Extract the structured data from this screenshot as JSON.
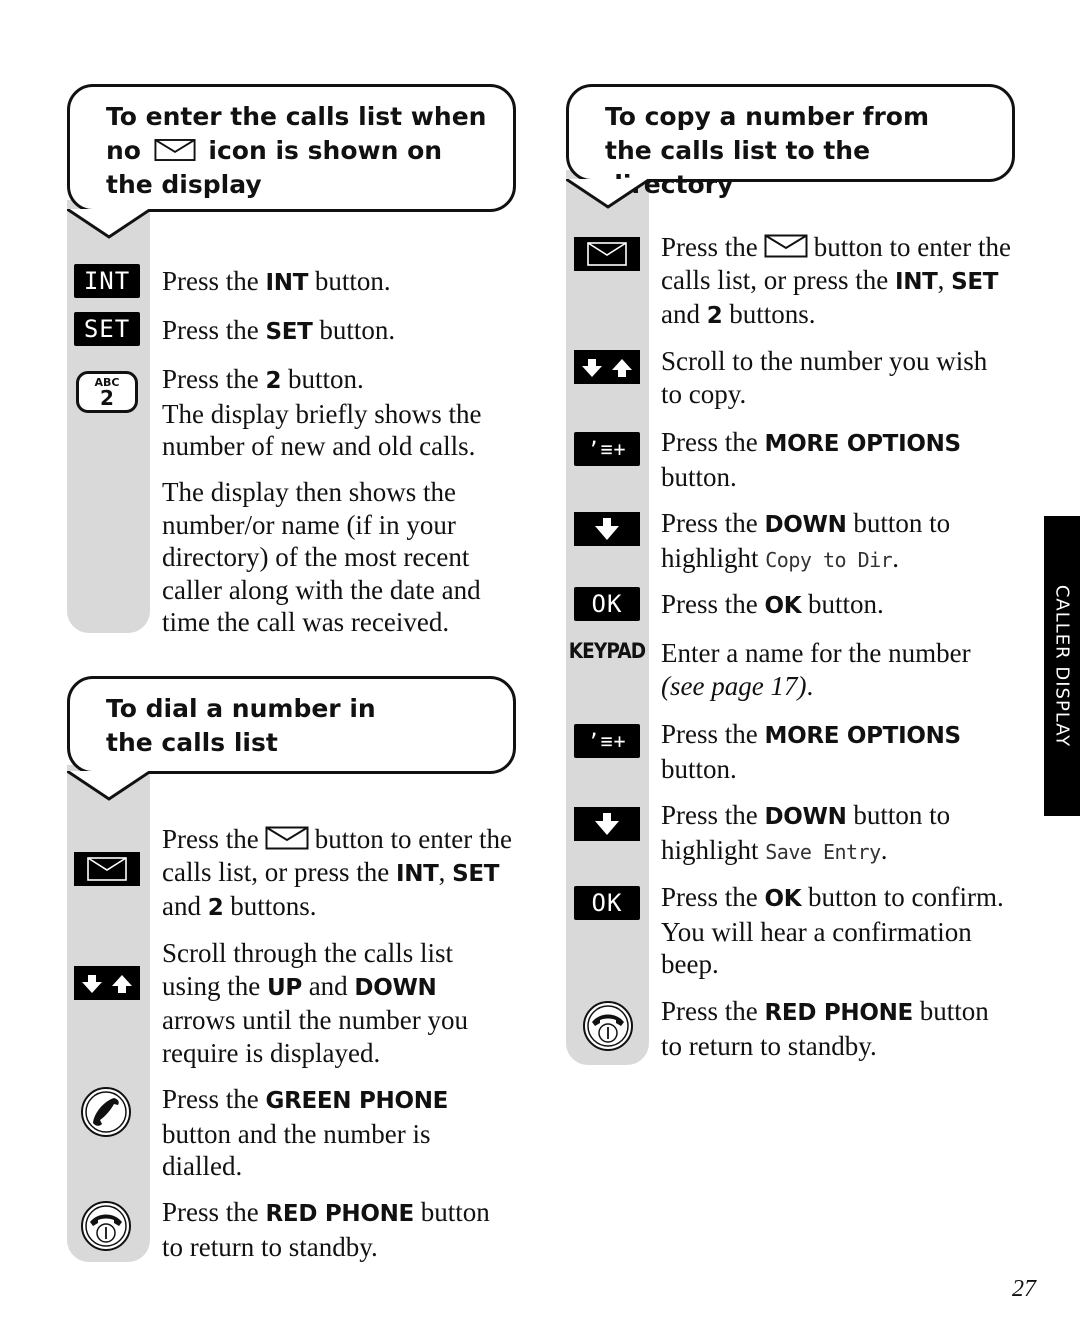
{
  "page_number": "27",
  "side_tab": "CALLER DISPLAY",
  "left": {
    "section1": {
      "title_part1": "To enter the calls list when no",
      "title_icon": "envelope-icon",
      "title_part2": "icon is shown on the display",
      "steps": [
        {
          "icon": "INT",
          "pre": "Press the ",
          "bold": "INT",
          "post": " button."
        },
        {
          "icon": "SET",
          "pre": "Press the ",
          "bold": "SET",
          "post": " button."
        },
        {
          "icon_top": "ABC",
          "icon_num": "2",
          "pre": "Press the ",
          "bold": "2",
          "post": " button.",
          "extra": "The display briefly shows the number of new and old calls."
        },
        {
          "text": "The display then shows the number/or name (if in your directory) of the most recent caller along with the date and time the call was received."
        }
      ]
    },
    "section2": {
      "title": "To dial a number in the calls list",
      "steps": [
        {
          "icon": "envelope-key-icon",
          "pre": "Press the",
          "post": "button to enter the calls list, or press the",
          "b1": "INT",
          "comma": ",",
          "b2": "SET",
          "and": " and ",
          "b3": "2",
          "end": " buttons."
        },
        {
          "icon": "down-up-arrows-icon",
          "pre": "Scroll through the calls list using the ",
          "b1": "UP",
          "mid": " and ",
          "b2": "DOWN",
          "post": " arrows until the number you require is displayed."
        },
        {
          "icon": "green-phone-icon",
          "pre": "Press the ",
          "bold": "GREEN PHONE",
          "post": " button and the number is dialled."
        },
        {
          "icon": "red-phone-icon",
          "pre": "Press the ",
          "bold": "RED PHONE",
          "post": " button to return to standby."
        }
      ]
    }
  },
  "right": {
    "section": {
      "title": "To copy a number from the calls list to the directory",
      "steps": [
        {
          "icon": "envelope-key-icon",
          "pre": "Press the",
          "post": "button to enter the calls list, or press the",
          "b1": "INT",
          "comma": ",",
          "b2": "SET",
          "and": " and ",
          "b3": "2",
          "end": " buttons."
        },
        {
          "icon": "down-up-arrows-icon",
          "text": "Scroll to the number you wish to copy."
        },
        {
          "icon": "more-options-icon",
          "icon_label": "ʼ≡+",
          "pre": "Press the ",
          "bold": "MORE OPTIONS",
          "post": " button."
        },
        {
          "icon": "down-arrow-icon",
          "pre": "Press the ",
          "bold": "DOWN",
          "post": " button to highlight ",
          "lcd": "Copy to Dir",
          "end": "."
        },
        {
          "icon": "OK",
          "pre": "Press the ",
          "bold": "OK",
          "post": " button."
        },
        {
          "icon": "KEYPAD",
          "pre": "Enter a name for the number ",
          "italic": "(see page 17)",
          "end": "."
        },
        {
          "icon": "more-options-icon",
          "icon_label": "ʼ≡+",
          "pre": "Press the ",
          "bold": "MORE OPTIONS",
          "post": " button."
        },
        {
          "icon": "down-arrow-icon",
          "pre": "Press the ",
          "bold": "DOWN",
          "post": " button to highlight ",
          "lcd": "Save Entry",
          "end": "."
        },
        {
          "icon": "OK",
          "pre": "Press the ",
          "bold": "OK",
          "post": " button to confirm. You will hear a confirmation beep."
        },
        {
          "icon": "red-phone-icon",
          "pre": "Press the ",
          "bold": "RED PHONE",
          "post": " button to return to standby."
        }
      ]
    }
  }
}
